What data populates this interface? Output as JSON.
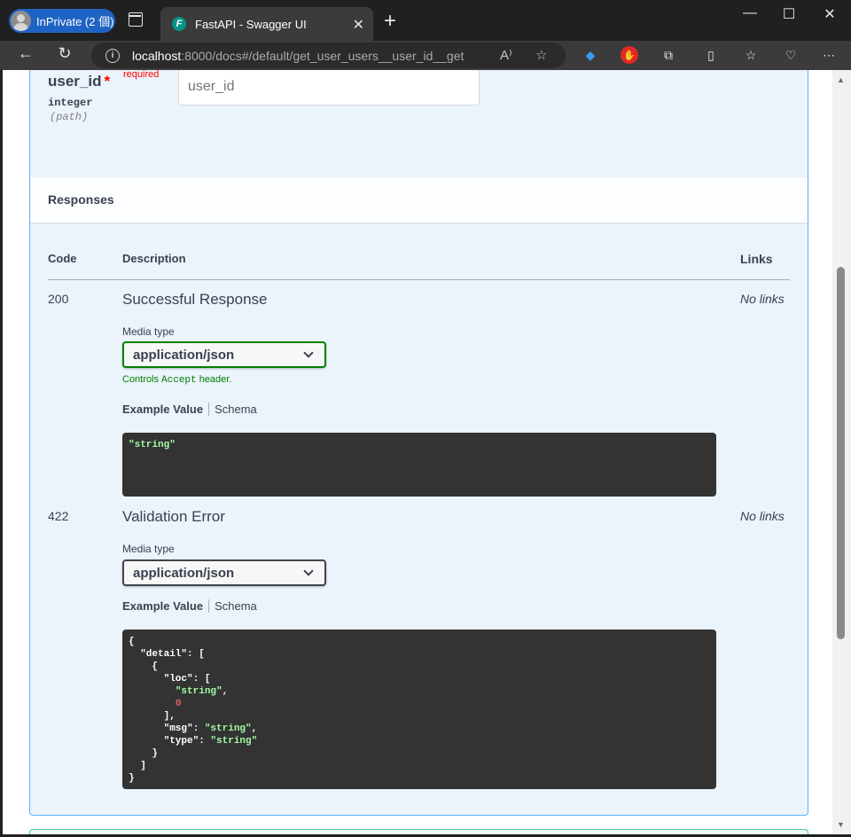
{
  "browser": {
    "inprivate_label": "InPrivate (2 個)",
    "tab_title": "FastAPI - Swagger UI",
    "tab_favicon": "F",
    "url_host": "localhost",
    "url_rest": ":8000/docs#/default/get_user_users__user_id__get"
  },
  "param": {
    "name": "user_id",
    "required_label": "required",
    "type": "integer",
    "in": "(path)",
    "placeholder": "user_id"
  },
  "responses": {
    "title": "Responses",
    "headers": {
      "code": "Code",
      "description": "Description",
      "links": "Links"
    },
    "items": [
      {
        "code": "200",
        "description": "Successful Response",
        "links": "No links",
        "media_type_label": "Media type",
        "media_type": "application/json",
        "controls_text": "Controls ",
        "controls_code": "Accept",
        "controls_suffix": " header.",
        "tab_example": "Example Value",
        "tab_schema": "Schema"
      },
      {
        "code": "422",
        "description": "Validation Error",
        "links": "No links",
        "media_type_label": "Media type",
        "media_type": "application/json",
        "tab_example": "Example Value",
        "tab_schema": "Schema"
      }
    ]
  }
}
